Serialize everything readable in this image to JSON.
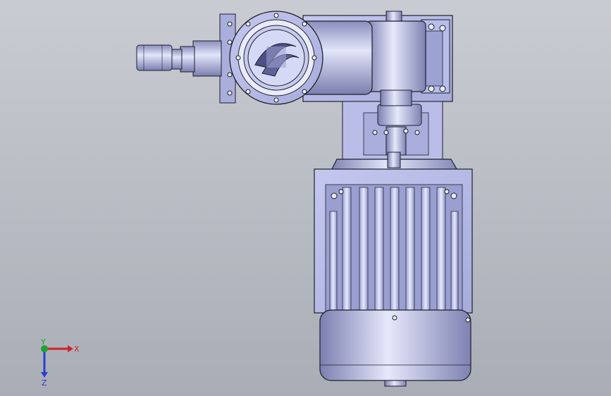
{
  "viewport": {
    "background_top": "#c9ccd2",
    "background_bottom": "#a9adb5"
  },
  "model": {
    "body_color": "#b6bbe8",
    "shadow_color": "#6e72a0",
    "edge_color": "#1e1f2a"
  },
  "triad": {
    "x_label": "X",
    "y_label": "Y",
    "z_label": "Z",
    "x_color": "#d0202a",
    "y_color": "#1fa12f",
    "z_color": "#2a3fd0"
  }
}
